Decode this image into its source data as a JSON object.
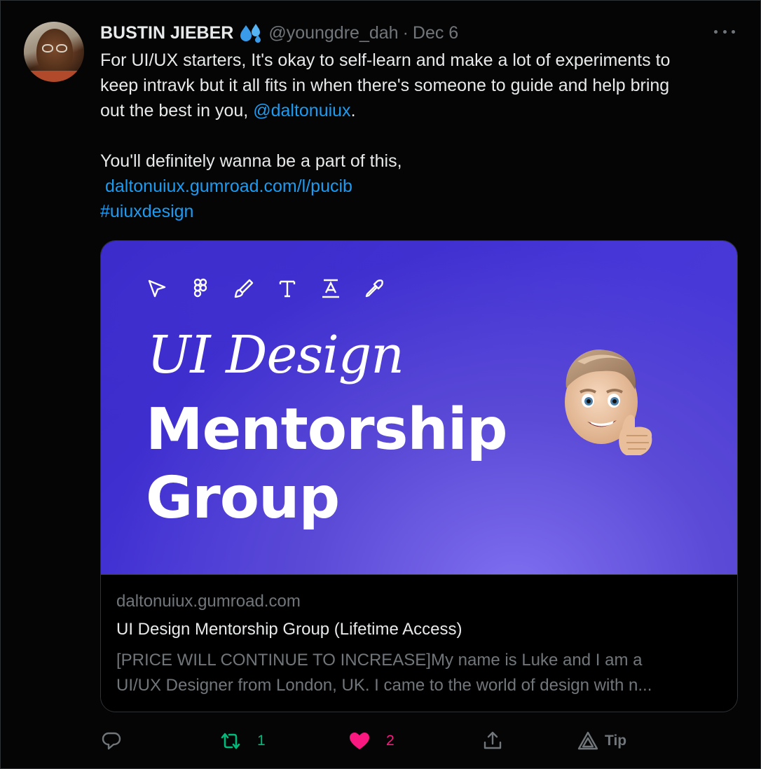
{
  "tweet": {
    "author_name": "BUSTIN JIEBER",
    "author_emoji": "sweat-droplets-icon",
    "handle": "@youngdre_dah",
    "separator": "·",
    "date": "Dec 6",
    "body": {
      "line1": "For UI/UX starters, It's okay to self-learn and make a lot of experiments to",
      "line2": "keep intravk but it all fits in when there's someone to guide and help bring",
      "line3_prefix": "out the best in you, ",
      "mention": "@daltonuiux",
      "line3_suffix": ".",
      "line4": "You'll definitely wanna be a part of this,",
      "url": "daltonuiux.gumroad.com/l/pucib",
      "hashtag": "#uiuxdesign"
    },
    "card": {
      "image_title_line1": "UI Design",
      "image_title_line2": "Mentorship",
      "image_title_line3": "Group",
      "domain": "daltonuiux.gumroad.com",
      "title": "UI Design Mentorship Group (Lifetime Access)",
      "description_line1": "[PRICE WILL CONTINUE TO INCREASE]My name is Luke and I am a",
      "description_line2": "UI/UX Designer from London, UK. I came to the world of design with n..."
    },
    "actions": {
      "retweets": "1",
      "likes": "2",
      "tip_label": "Tip"
    },
    "colors": {
      "link": "#1d9bf0",
      "retweet": "#00ba7c",
      "like": "#f91880",
      "muted": "#71767b"
    }
  }
}
